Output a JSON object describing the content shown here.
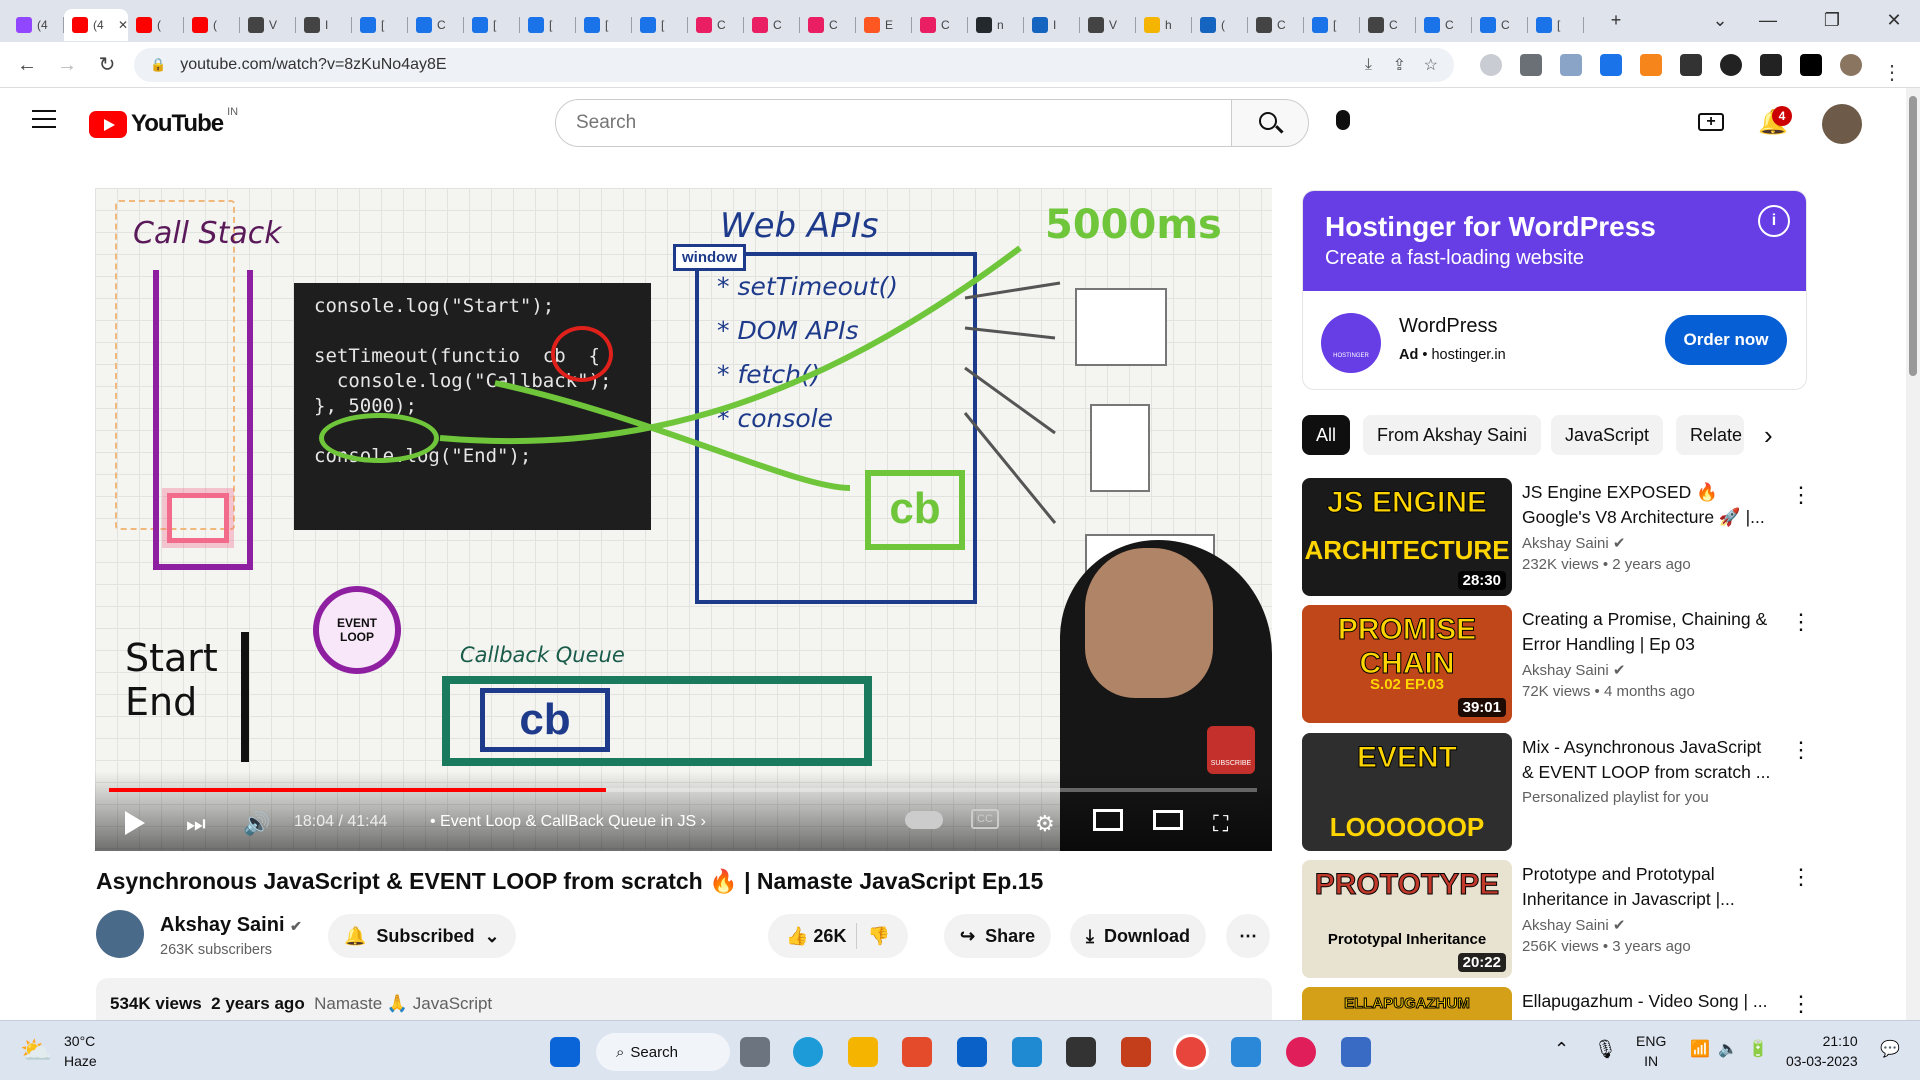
{
  "browser": {
    "tabs": [
      {
        "label": "(4",
        "color": "#9146ff"
      },
      {
        "label": "(4",
        "color": "#ff0000"
      },
      {
        "label": "(",
        "color": "#ff0000"
      },
      {
        "label": "(",
        "color": "#ff0000"
      },
      {
        "label": "V",
        "color": "#444"
      },
      {
        "label": "I",
        "color": "#444"
      },
      {
        "label": "[",
        "color": "#1a73e8"
      },
      {
        "label": "C",
        "color": "#1a73e8"
      },
      {
        "label": "[",
        "color": "#1a73e8"
      },
      {
        "label": "[",
        "color": "#1a73e8"
      },
      {
        "label": "[",
        "color": "#1a73e8"
      },
      {
        "label": "[",
        "color": "#1a73e8"
      },
      {
        "label": "C",
        "color": "#e91e63"
      },
      {
        "label": "C",
        "color": "#e91e63"
      },
      {
        "label": "C",
        "color": "#e91e63"
      },
      {
        "label": "E",
        "color": "#ff5722"
      },
      {
        "label": "C",
        "color": "#e91e63"
      },
      {
        "label": "n",
        "color": "#24292e"
      },
      {
        "label": "I",
        "color": "#1565c0"
      },
      {
        "label": "V",
        "color": "#444"
      },
      {
        "label": "h",
        "color": "#f4b400"
      },
      {
        "label": "(",
        "color": "#1565c0"
      },
      {
        "label": "C",
        "color": "#444"
      },
      {
        "label": "[",
        "color": "#1a73e8"
      },
      {
        "label": "C",
        "color": "#444"
      },
      {
        "label": "C",
        "color": "#1a73e8"
      },
      {
        "label": "C",
        "color": "#1a73e8"
      },
      {
        "label": "[",
        "color": "#1a73e8"
      }
    ],
    "url": "youtube.com/watch?v=8zKuNo4ay8E"
  },
  "youtube": {
    "logo_text": "YouTube",
    "country": "IN",
    "search_placeholder": "Search",
    "notification_count": "4"
  },
  "video": {
    "time": "18:04 / 41:44",
    "chapter": "Event Loop & CallBack Queue in JS",
    "progress": 0.4325,
    "code_lines": [
      "console.log(\"Start\");",
      "",
      "setTimeout(functio  cb  {",
      "  console.log(\"Callback\");",
      "}, 5000);",
      "",
      "console.log(\"End\");"
    ],
    "board_labels": {
      "call_stack": "Call Stack",
      "web_apis": "Web APIs",
      "window": "window",
      "settimeout": "* setTimeout()",
      "dom": "* DOM APIs",
      "fetch": "* fetch()",
      "console": "* console",
      "timer": "5000ms",
      "cb": "cb",
      "event_loop": "EVENT LOOP",
      "start_end": "Start End",
      "callback_queue": "Callback Queue",
      "subscribe": "SUBSCRIBE"
    },
    "title": "Asynchronous JavaScript & EVENT LOOP from scratch 🔥 | Namaste JavaScript Ep.15",
    "channel": "Akshay Saini",
    "subscribers": "263K subscribers",
    "subscribed_label": "Subscribed",
    "likes": "26K",
    "share_label": "Share",
    "download_label": "Download",
    "views": "534K views",
    "age": "2 years ago",
    "tags": "Namaste 🙏 JavaScript"
  },
  "ad": {
    "headline": "Hostinger for WordPress",
    "sub": "Create a fast-loading website",
    "brand": "WordPress",
    "ad_label": "Ad",
    "domain": "hostinger.in",
    "cta": "Order now",
    "logo_text": "HOSTINGER"
  },
  "chips": [
    "All",
    "From Akshay Saini",
    "JavaScript",
    "Relate"
  ],
  "recommendations": [
    {
      "title": "JS Engine EXPOSED 🔥 Google's V8 Architecture 🚀 |...",
      "channel": "Akshay Saini",
      "meta": "232K views • 2 years ago",
      "duration": "28:30",
      "thumb_text": "JS ENGINE",
      "thumb_text2": "ARCHITECTURE",
      "bg": "#1a1a1a"
    },
    {
      "title": "Creating a Promise, Chaining & Error Handling | Ep 03 Season...",
      "channel": "Akshay Saini",
      "meta": "72K views • 4 months ago",
      "duration": "39:01",
      "thumb_text": "PROMISE CHAIN",
      "thumb_text2": "S.02 EP.03",
      "bg": "#c0471a"
    },
    {
      "title": "Mix - Asynchronous JavaScript & EVENT LOOP from scratch ...",
      "channel": "",
      "meta": "Personalized playlist for you",
      "duration": "",
      "thumb_text": "EVENT",
      "thumb_text2": "LOOOOOOP",
      "bg": "#2e2e2e"
    },
    {
      "title": "Prototype and Prototypal Inheritance in Javascript |...",
      "channel": "Akshay Saini",
      "meta": "256K views • 3 years ago",
      "duration": "20:22",
      "thumb_text": "PROTOTYPE",
      "thumb_text2": "Prototypal Inheritance",
      "bg": "#e8e2d0"
    },
    {
      "title": "Ellapugazhum - Video Song | ...",
      "channel": "",
      "meta": "",
      "duration": "",
      "thumb_text": "ELLAPUGAZHUM",
      "thumb_text2": "VIDEO SONG",
      "bg": "#d4a017"
    }
  ],
  "taskbar": {
    "weather_temp": "30°C",
    "weather_desc": "Haze",
    "search_label": "Search",
    "lang1": "ENG",
    "lang2": "IN",
    "time": "21:10",
    "date": "03-03-2023"
  }
}
